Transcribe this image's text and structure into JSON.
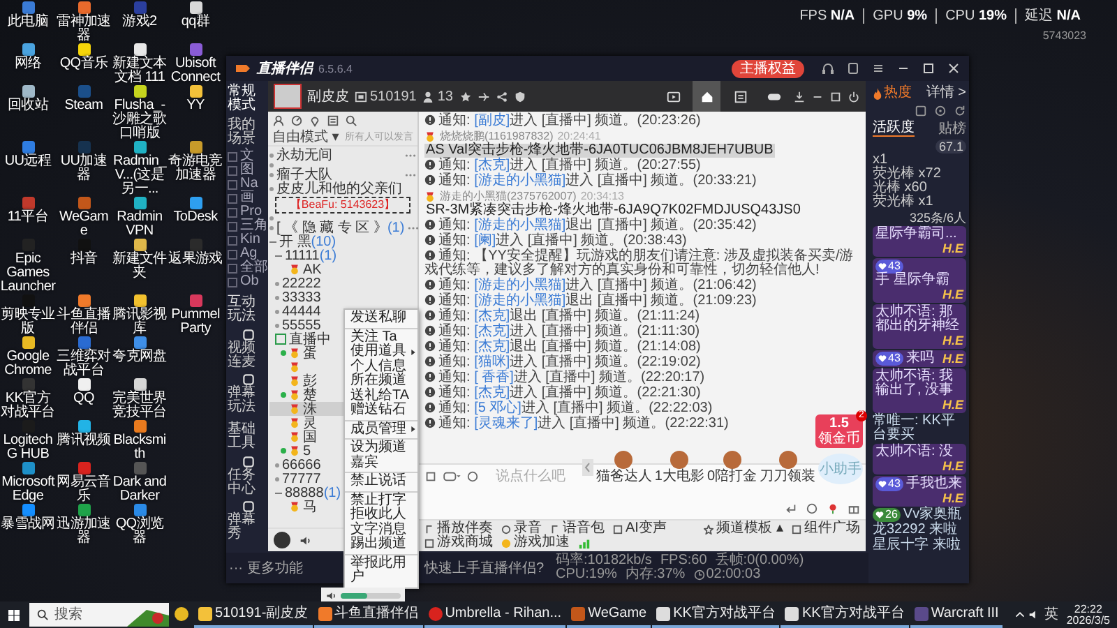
{
  "desktop": {
    "columns": [
      [
        {
          "label": "此电脑",
          "color": "#3a7bd5"
        },
        {
          "label": "网络",
          "color": "#4aa3df"
        },
        {
          "label": "回收站",
          "color": "#9fb8c8"
        },
        {
          "label": "UU远程",
          "color": "#2f7de1"
        },
        {
          "label": "11平台",
          "color": "#c0392b"
        },
        {
          "label": "Epic Games Launcher",
          "color": "#222222"
        },
        {
          "label": "剪映专业版",
          "color": "#111111"
        },
        {
          "label": "Google Chrome",
          "color": "#e8b923"
        },
        {
          "label": "KK官方对战平台",
          "color": "#333333"
        },
        {
          "label": "Logitech G HUB",
          "color": "#1b1b1b"
        },
        {
          "label": "Microsoft Edge",
          "color": "#1e90c8"
        },
        {
          "label": "暴雪战网",
          "color": "#148eff"
        }
      ],
      [
        {
          "label": "雷神加速器",
          "color": "#e86a2c"
        },
        {
          "label": "QQ音乐",
          "color": "#f5d50a"
        },
        {
          "label": "Steam",
          "color": "#1b4f8a"
        },
        {
          "label": "UU加速器",
          "color": "#16324f"
        },
        {
          "label": "WeGame",
          "color": "#c2571a"
        },
        {
          "label": "抖音",
          "color": "#111111"
        },
        {
          "label": "斗鱼直播伴侣",
          "color": "#f07a2a"
        },
        {
          "label": "三维弈对战平台",
          "color": "#2a6bd1"
        },
        {
          "label": "QQ",
          "color": "#f0f0f0"
        },
        {
          "label": "腾讯视频",
          "color": "#22b3e6"
        },
        {
          "label": "网易云音乐",
          "color": "#d8231e"
        },
        {
          "label": "迅游加速器",
          "color": "#1fa34a"
        }
      ],
      [
        {
          "label": "游戏2",
          "color": "#2b3f9e"
        },
        {
          "label": "新建文本文档 111",
          "color": "#e8e8e8"
        },
        {
          "label": "Flusha_-沙雕之歌口哨版",
          "color": "#c6d41e"
        },
        {
          "label": "Radmin_V...(这是另一...",
          "color": "#20b2c4"
        },
        {
          "label": "Radmin VPN",
          "color": "#20b2c4"
        },
        {
          "label": "新建文件夹",
          "color": "#e0b84a"
        },
        {
          "label": "腾讯影视库",
          "color": "#f2c12e"
        },
        {
          "label": "夸克网盘",
          "color": "#3f8fe8"
        },
        {
          "label": "完美世界竞技平台",
          "color": "#d6d6d6"
        },
        {
          "label": "Blacksmith",
          "color": "#e87a1e"
        },
        {
          "label": "Dark and Darker",
          "color": "#555555"
        },
        {
          "label": "QQ浏览器",
          "color": "#2a8ae6"
        }
      ],
      [
        {
          "label": "qq群",
          "color": "#d9d9d9"
        },
        {
          "label": "Ubisoft Connect",
          "color": "#8a5cd6"
        },
        {
          "label": "YY",
          "color": "#f3c13a"
        },
        {
          "label": "奇游电竞加速器",
          "color": "#c89b2a"
        },
        {
          "label": "ToDesk",
          "color": "#2e9ff0"
        },
        {
          "label": "返果游戏",
          "color": "#2b2b2b"
        },
        {
          "label": "Pummel Party",
          "color": "#d8385c"
        }
      ]
    ]
  },
  "overlay": {
    "stats": [
      {
        "label": "FPS",
        "value": "N/A"
      },
      {
        "label": "GPU",
        "value": "9%"
      },
      {
        "label": "CPU",
        "value": "19%"
      },
      {
        "label": "延迟",
        "value": "N/A"
      }
    ],
    "code": "5743023"
  },
  "companion": {
    "title": "直播伴侣",
    "version": "6.5.6.4",
    "perks": "主播权益",
    "nav": {
      "mode": "常规模式",
      "scenes_title": "我的场景",
      "scenes": [
        "文",
        "图",
        "Na",
        "画",
        "Pro",
        "三角",
        "Kin",
        "Ag",
        "全部",
        "Ob"
      ],
      "sections": [
        {
          "title": "互动玩法",
          "items": [
            "视频连麦",
            "弹幕玩法"
          ]
        },
        {
          "title": "基础工具",
          "items": [
            "任务中心",
            "弹幕秀"
          ]
        }
      ]
    },
    "panel": {
      "heat": "热度",
      "details": "详情 >",
      "tabs": [
        {
          "label": "活跃度",
          "selected": true
        },
        {
          "label": "贴榜",
          "selected": false
        }
      ],
      "score": "67.1",
      "gifts": [
        "x1",
        "荧光棒 x72",
        "光棒 x60",
        "荧光棒 x1"
      ],
      "count": "325条/6人",
      "chat": [
        {
          "kind": "bubble",
          "lines": [
            "星际争霸司..."
          ],
          "tag": "H.E"
        },
        {
          "kind": "bubble",
          "rank": "43",
          "lines": [
            "手 星际争霸"
          ],
          "tag": "H.E"
        },
        {
          "kind": "bubble",
          "lines": [
            "太帅不语: 那",
            "都出的牙神经"
          ],
          "tag": "H.E"
        },
        {
          "kind": "bubble",
          "rank": "43",
          "lines": [
            "来吗"
          ],
          "tag": "H.E"
        },
        {
          "kind": "bubble",
          "lines": [
            "太帅不语: 我",
            "输出了, 没事"
          ],
          "tag": "H.E"
        },
        {
          "kind": "plain",
          "lines": [
            "常唯一: KK平台要买"
          ]
        },
        {
          "kind": "bubble",
          "lines": [
            "太帅不语: 没"
          ],
          "tag": "H.E"
        },
        {
          "kind": "bubble",
          "rank": "43",
          "lines": [
            "手我也来"
          ],
          "tag": "H.E"
        },
        {
          "kind": "plain",
          "rank": "26",
          "lines": [
            "Vv家奥瓶"
          ]
        },
        {
          "kind": "plain",
          "lines": [
            "龙32292 来啦"
          ]
        },
        {
          "kind": "plain",
          "lines": [
            "星辰十字 来啦"
          ]
        }
      ]
    },
    "footer": {
      "more": "··· 更多功能",
      "tip": "快速上手直播伴侣?",
      "stats": [
        "码率:10182kb/s",
        "FPS:60",
        "丢帧:0(0.00%)",
        "CPU:19%",
        "内存:37%"
      ],
      "timer": "02:00:03"
    }
  },
  "yy": {
    "name": "副皮皮",
    "room": "510191",
    "users": "13",
    "nav": [
      {
        "kind": "video",
        "selected": false
      },
      {
        "kind": "home",
        "selected": true
      },
      {
        "kind": "list",
        "selected": false
      },
      {
        "kind": "game",
        "selected": false
      }
    ],
    "mode": "自由模式 ▾",
    "speak": "所有人可以发言",
    "tree": [
      {
        "kind": "channel",
        "label": "永劫无间",
        "more": true
      },
      {
        "kind": "blank"
      },
      {
        "kind": "channel",
        "label": "瘤子大队",
        "more": true
      },
      {
        "kind": "channel",
        "label": "皮皮儿和他的父亲们",
        "more": false
      },
      {
        "kind": "banner",
        "label": "【BeaFu: 5143623】"
      },
      {
        "kind": "blank"
      },
      {
        "kind": "channel",
        "label": "[ 《 隐 藏 专 区 》",
        "count": "(1)",
        "more": true
      },
      {
        "kind": "group",
        "label": "开 黑",
        "count": "(10)",
        "expanded": true,
        "children": [
          {
            "kind": "group",
            "label": "11111",
            "count": "(1)",
            "expanded": true,
            "children": [
              {
                "kind": "user",
                "label": "AK",
                "online": false,
                "selected": false
              }
            ]
          },
          {
            "kind": "group",
            "label": "22222",
            "expanded": false
          },
          {
            "kind": "group",
            "label": "33333",
            "expanded": false
          },
          {
            "kind": "group",
            "label": "44444",
            "expanded": false
          },
          {
            "kind": "group",
            "label": "55555",
            "expanded": false
          },
          {
            "kind": "live",
            "label": "直播中",
            "expanded": true,
            "children": [
              {
                "kind": "user",
                "label": "蛋",
                "online": true,
                "selected": false
              },
              {
                "kind": "user",
                "online": false,
                "selected": false
              },
              {
                "kind": "user",
                "label": "彭",
                "online": false,
                "selected": false
              },
              {
                "kind": "user",
                "label": "楚",
                "online": true,
                "selected": false
              },
              {
                "kind": "user",
                "label": "洙",
                "online": false,
                "selected": true
              },
              {
                "kind": "user",
                "label": "灵",
                "online": false,
                "selected": false
              },
              {
                "kind": "user",
                "label": "国",
                "online": false,
                "selected": false
              },
              {
                "kind": "user",
                "label": "5",
                "online": true,
                "selected": false
              }
            ]
          },
          {
            "kind": "group",
            "label": "66666",
            "expanded": false
          },
          {
            "kind": "group",
            "label": "77777",
            "expanded": false
          },
          {
            "kind": "group",
            "label": "88888",
            "count": "(1)",
            "expanded": true,
            "children": [
              {
                "kind": "user",
                "label": "马",
                "online": false,
                "selected": false
              }
            ]
          }
        ]
      }
    ],
    "messages": [
      {
        "kind": "notice",
        "label": "通知:",
        "name": "[副皮]",
        "text": "进入 [直播中] 频道。",
        "time": "(20:23:26)"
      },
      {
        "kind": "message",
        "sender": "烧烧烧鹏(1161987832)",
        "time": "20:24:41",
        "text": "AS Val突击步枪-烽火地带-6JA0TUC06JBM8JEH7UBUB",
        "highlighted": true
      },
      {
        "kind": "notice",
        "label": "通知:",
        "name": "[杰克]",
        "text": "进入 [直播中] 频道。",
        "time": "(20:27:55)"
      },
      {
        "kind": "notice",
        "label": "通知:",
        "name": "[游走的小黑猫]",
        "text": "进入 [直播中] 频道。",
        "time": "(20:33:21)"
      },
      {
        "kind": "message",
        "sender": "游走的小黑猫(2375762007)",
        "time": "20:34:13",
        "text": "SR-3M紧凑突击步枪-烽火地带-6JA9Q7K02FMDJUSQ43JS0",
        "highlighted": false
      },
      {
        "kind": "notice",
        "label": "通知:",
        "name": "[游走的小黑猫]",
        "text": "退出 [直播中] 频道。",
        "time": "(20:35:42)"
      },
      {
        "kind": "notice",
        "label": "通知:",
        "name": "[阑]",
        "text": "进入 [直播中] 频道。",
        "time": "(20:38:43)"
      },
      {
        "kind": "notice",
        "label": "通知:",
        "text": "【YY安全提醒】玩游戏的朋友们请注意: 涉及虚拟装备买卖/游戏代练等，建议多了解对方的真实身份和可靠性，切勿轻信他人!"
      },
      {
        "kind": "notice",
        "label": "通知:",
        "name": "[游走的小黑猫]",
        "text": "进入 [直播中] 频道。",
        "time": "(21:06:42)"
      },
      {
        "kind": "notice",
        "label": "通知:",
        "name": "[游走的小黑猫]",
        "text": "退出 [直播中] 频道。",
        "time": "(21:09:23)"
      },
      {
        "kind": "notice",
        "label": "通知:",
        "name": "[杰克]",
        "text": "退出 [直播中] 频道。",
        "time": "(21:11:24)"
      },
      {
        "kind": "notice",
        "label": "通知:",
        "name": "[杰克]",
        "text": "进入 [直播中] 频道。",
        "time": "(21:11:30)"
      },
      {
        "kind": "notice",
        "label": "通知:",
        "name": "[杰克]",
        "text": "退出 [直播中] 频道。",
        "time": "(21:14:08)"
      },
      {
        "kind": "notice",
        "label": "通知:",
        "name": "[猫咪]",
        "text": "进入 [直播中] 频道。",
        "time": "(22:19:02)"
      },
      {
        "kind": "notice",
        "label": "通知:",
        "name": "[ 香香]",
        "text": "进入 [直播中] 频道。",
        "time": "(22:20:17)"
      },
      {
        "kind": "notice",
        "label": "通知:",
        "name": "[杰克]",
        "text": "进入 [直播中] 频道。",
        "time": "(22:21:30)"
      },
      {
        "kind": "notice",
        "label": "通知:",
        "name": "[5 邓心]",
        "text": "进入 [直播中] 频道。",
        "time": "(22:22:03)"
      },
      {
        "kind": "notice",
        "label": "通知:",
        "name": "[灵魂来了]",
        "text": "进入 [直播中] 频道。",
        "time": "(22:22:31)"
      }
    ],
    "promo": {
      "amount": "1.5",
      "badge": "2",
      "label": "领金币",
      "helper": "小助手",
      "hosts": [
        "猫爸达人",
        "1大电影",
        "0陪打金",
        "刀刀领装"
      ]
    },
    "input_placeholder": "说点什么吧",
    "tools": [
      {
        "kind": "music",
        "label": "播放伴奏"
      },
      {
        "kind": "record",
        "label": "录音"
      },
      {
        "kind": "voice",
        "label": "语音包"
      },
      {
        "kind": "ai",
        "label": "AI变声"
      }
    ],
    "tools_right": [
      {
        "kind": "template",
        "label": "频道模板 ▴"
      },
      {
        "kind": "grid",
        "label": "组件广场"
      },
      {
        "kind": "shop",
        "label": "游戏商城"
      },
      {
        "kind": "boost",
        "label": "游戏加速"
      }
    ]
  },
  "context_menu": [
    {
      "label": "发送私聊",
      "submenu": false,
      "divider": true
    },
    {
      "label": "关注 Ta",
      "submenu": false,
      "divider": false
    },
    {
      "label": "使用道具",
      "submenu": true,
      "divider": false
    },
    {
      "label": "个人信息",
      "submenu": false,
      "divider": false
    },
    {
      "label": "所在频道",
      "submenu": false,
      "divider": false
    },
    {
      "label": "送礼给TA",
      "submenu": false,
      "divider": false
    },
    {
      "label": "赠送钻石",
      "submenu": false,
      "divider": true
    },
    {
      "label": "成员管理",
      "submenu": true,
      "divider": true
    },
    {
      "label": "设为频道嘉宾",
      "submenu": false,
      "divider": true
    },
    {
      "label": "禁止说话",
      "submenu": false,
      "divider": true
    },
    {
      "label": "禁止打字",
      "submenu": false,
      "divider": false
    },
    {
      "label": "拒收此人文字消息",
      "submenu": false,
      "divider": false
    },
    {
      "label": "踢出频道",
      "submenu": false,
      "divider": true
    },
    {
      "label": "举报此用户",
      "submenu": false,
      "divider": false
    }
  ],
  "volume": {
    "level": 0.45
  },
  "taskbar": {
    "search": "搜索",
    "apps": [
      {
        "kind": "chrome",
        "running": false
      },
      {
        "kind": "yy",
        "label": "510191-副皮皮",
        "running": true
      },
      {
        "kind": "douyu",
        "label": "斗鱼直播伴侣",
        "running": true
      },
      {
        "kind": "music",
        "label": "Umbrella - Rihan...",
        "running": true
      },
      {
        "kind": "wegame",
        "label": "WeGame",
        "running": true
      },
      {
        "kind": "kk",
        "label": "KK官方对战平台",
        "running": true
      },
      {
        "kind": "kk",
        "label": "KK官方对战平台",
        "running": true
      },
      {
        "kind": "war",
        "label": "Warcraft III",
        "running": true
      }
    ],
    "lang": "英",
    "time": "22:22",
    "date": "2026/3/5"
  }
}
